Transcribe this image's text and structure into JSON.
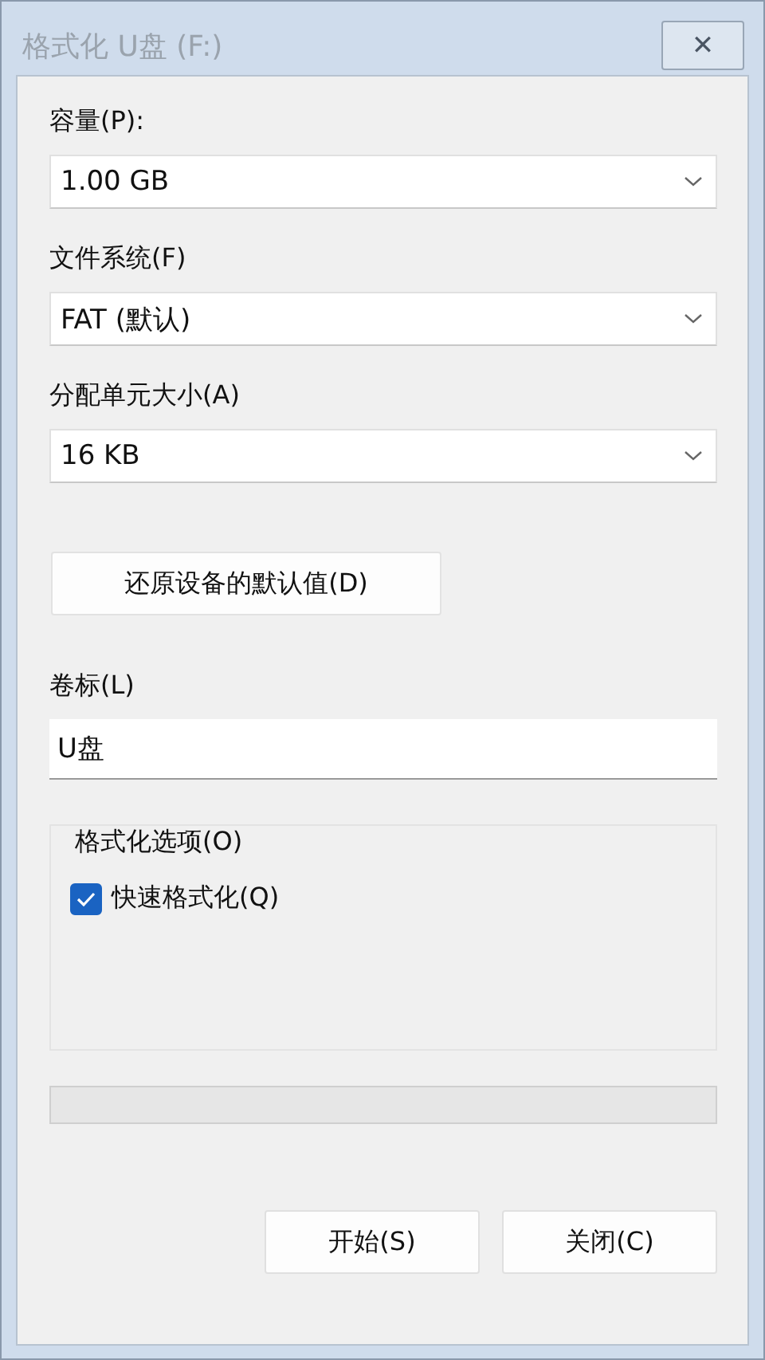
{
  "window": {
    "title": "格式化 U盘 (F:)",
    "close": "✕"
  },
  "fields": [
    {
      "kind": "dropdown",
      "label": "容量(P):",
      "value": "1.00 GB"
    },
    {
      "kind": "dropdown",
      "label": "文件系统(F)",
      "value": "FAT (默认)"
    },
    {
      "kind": "dropdown",
      "label": "分配单元大小(A)",
      "value": "16 KB"
    }
  ],
  "restore_button": "还原设备的默认值(D)",
  "volume_label": {
    "label": "卷标(L)",
    "value": "U盘"
  },
  "options": {
    "title": "格式化选项(O)",
    "items": [
      {
        "label": "快速格式化(Q)",
        "checked": true
      }
    ]
  },
  "progress": {
    "level": 0
  },
  "buttons": [
    "开始(S)",
    "关闭(C)"
  ]
}
